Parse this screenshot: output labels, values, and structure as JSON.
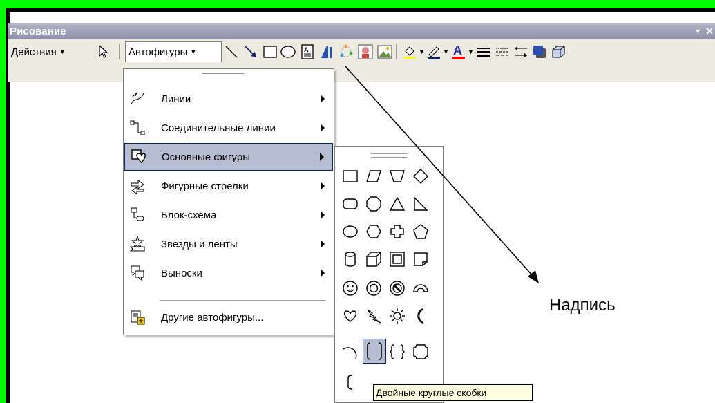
{
  "window": {
    "title": "Рисование",
    "dropdown_glyph": "▾",
    "close_glyph": "✕"
  },
  "toolbar": {
    "actions_label": "Действия",
    "autoshapes_label": "Автофигуры",
    "icons": [
      "select-pointer-icon",
      "line-icon",
      "arrow-icon",
      "rectangle-icon",
      "oval-icon",
      "text-box-icon",
      "wordart-icon",
      "diagram-icon",
      "clipart-icon",
      "picture-icon",
      "fill-color-icon",
      "line-color-icon",
      "font-color-icon",
      "line-style-icon",
      "dash-style-icon",
      "arrow-style-icon",
      "shadow-icon",
      "3d-icon"
    ],
    "font_color_letter": "A"
  },
  "autoshapes_menu": {
    "items": [
      {
        "label": "Линии",
        "icon": "lines-icon",
        "submenu": true
      },
      {
        "label": "Соединительные линии",
        "icon": "connectors-icon",
        "submenu": true
      },
      {
        "label": "Основные фигуры",
        "icon": "basic-shapes-icon",
        "submenu": true,
        "highlighted": true
      },
      {
        "label": "Фигурные стрелки",
        "icon": "block-arrows-icon",
        "submenu": true
      },
      {
        "label": "Блок-схема",
        "icon": "flowchart-icon",
        "submenu": true
      },
      {
        "label": "Звезды и ленты",
        "icon": "stars-banners-icon",
        "submenu": true
      },
      {
        "label": "Выноски",
        "icon": "callouts-icon",
        "submenu": true
      },
      {
        "label": "Другие автофигуры...",
        "icon": "more-autoshapes-icon",
        "submenu": false
      }
    ]
  },
  "basic_shapes_palette": {
    "highlighted_shape": "double-bracket",
    "tooltip": "Двойные круглые скобки"
  },
  "annotation": {
    "label": "Надпись"
  },
  "colors": {
    "border_green": "#00ff00",
    "titlebar": "#9c9db5",
    "toolbar": "#eceae1",
    "highlight": "#b6bdd2",
    "highlight_border": "#0a246a",
    "tooltip_bg": "#ffffe1",
    "font_color_bar": "#ff0000"
  }
}
